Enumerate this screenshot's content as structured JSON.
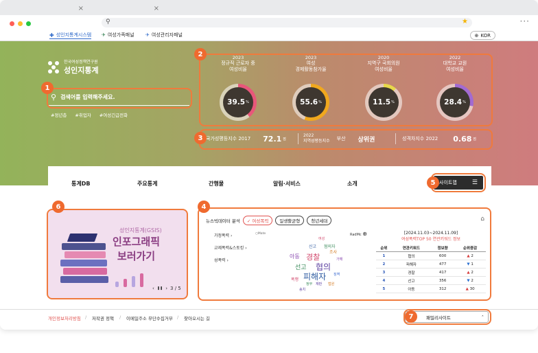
{
  "browser": {
    "tab_close": "×",
    "url_icon": "search-icon",
    "star": "★",
    "menu": "···"
  },
  "bookmarks": [
    {
      "label": "성인지통계시스템"
    },
    {
      "label": "여성가족패널"
    },
    {
      "label": "여성관리자패널"
    }
  ],
  "lang": {
    "label": "KOR"
  },
  "brand": {
    "org": "한국여성정책연구원",
    "name": "성인지통계"
  },
  "search": {
    "placeholder": "검색어를 입력해주세요."
  },
  "tags": [
    "#정년층",
    "#취업자",
    "#여성긴급전화"
  ],
  "stats": [
    {
      "year": "2023",
      "label1": "정규직 근로자 중",
      "label2": "여성비율",
      "value": "39.5",
      "unit": "%",
      "pct": 39.5,
      "color": "#e8577a"
    },
    {
      "year": "2023",
      "label1": "여성",
      "label2": "경제활동참가율",
      "value": "55.6",
      "unit": "%",
      "pct": 55.6,
      "color": "#f0a81e"
    },
    {
      "year": "2020",
      "label1": "지역구 국회의원",
      "label2": "여성비율",
      "value": "11.5",
      "unit": "%",
      "pct": 11.5,
      "color": "#e7d84a"
    },
    {
      "year": "2022",
      "label1": "대학교 교원",
      "label2": "여성비율",
      "value": "28.4",
      "unit": "%",
      "pct": 28.4,
      "color": "#a26ad1"
    }
  ],
  "indices": [
    {
      "label": "국가성평등지수",
      "year": "2017",
      "value": "72.1",
      "unit": "점"
    },
    {
      "year": "2022",
      "label": "지역성평등지수",
      "region": "부산",
      "value": "상위권"
    },
    {
      "label": "성격차지수",
      "year": "2022",
      "value": "0.68",
      "unit": "점"
    }
  ],
  "nav": {
    "items": [
      "통계DB",
      "주요통계",
      "간행물",
      "알림·서비스",
      "소개"
    ],
    "sitemap": "사이트맵"
  },
  "badges": [
    "1",
    "2",
    "3",
    "4",
    "5",
    "6",
    "7"
  ],
  "infographic": {
    "subtitle": "성인지통계(GSIS)",
    "title1": "인포그래픽",
    "title2": "보러가기",
    "page": "3 / 5",
    "prev": "‹",
    "pause": "❚❚",
    "next": "›"
  },
  "news": {
    "title": "뉴스빅데이터 분석",
    "tabs": [
      "여성폭력",
      "일생활균형",
      "청년세대"
    ],
    "categories": [
      "가정폭력",
      "교제폭력&스토킹",
      "성폭력"
    ],
    "cloud_label_left": "○Mate",
    "cloud_label_right": "RadMc",
    "cloud_words": [
      "협의",
      "경찰",
      "피해자",
      "선고",
      "아동",
      "조사",
      "징역",
      "재판",
      "여성",
      "폭행",
      "신고",
      "혐의자",
      "가해",
      "정부",
      "법원",
      "송치"
    ],
    "period": "[2024.11.03~2024.11.09]",
    "table_title": "여성폭력TOP 50 연관키워드 정보",
    "columns": [
      "순위",
      "연관키워드",
      "정보량",
      "순위증감"
    ],
    "rows": [
      {
        "rank": "1",
        "kw": "협의",
        "count": "600",
        "dir": "▲",
        "chg": "2"
      },
      {
        "rank": "2",
        "kw": "피해자",
        "count": "477",
        "dir": "▼",
        "chg": "1"
      },
      {
        "rank": "3",
        "kw": "경찰",
        "count": "417",
        "dir": "▲",
        "chg": "2"
      },
      {
        "rank": "4",
        "kw": "선고",
        "count": "356",
        "dir": "▼",
        "chg": "2"
      },
      {
        "rank": "5",
        "kw": "아동",
        "count": "312",
        "dir": "▲",
        "chg": "30"
      }
    ]
  },
  "footer": {
    "links": [
      "개인정보처리방침",
      "저작권 정책",
      "이메일주소 무단수집거부",
      "찾아오시는 길"
    ],
    "family": "패밀리사이트",
    "family_icon": "chevron-up-icon"
  }
}
